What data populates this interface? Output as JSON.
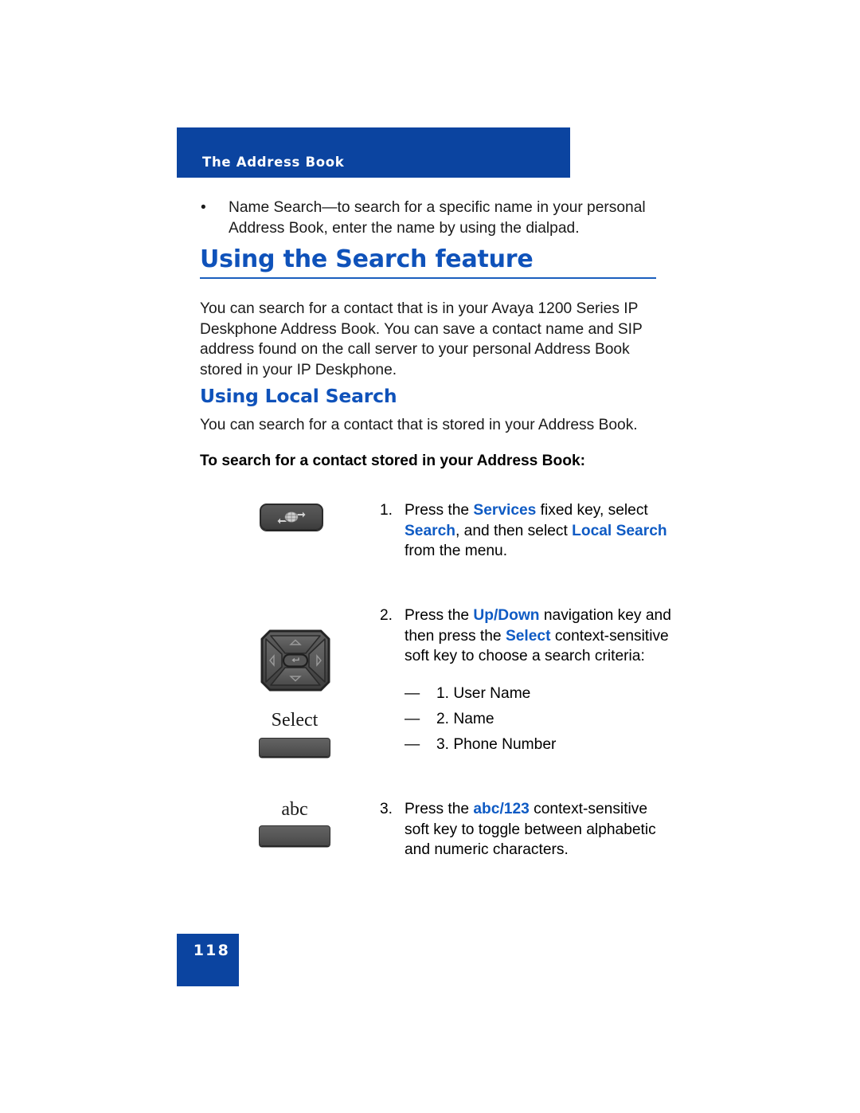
{
  "header": {
    "running_title": "The Address Book",
    "band_color": "#0b44a0"
  },
  "intro_bullet": {
    "marker": "•",
    "text": "Name Search—to search for a specific name in your personal Address Book, enter the name by using the dialpad."
  },
  "section": {
    "h1": "Using the Search feature",
    "h1_color": "#0f52ba",
    "paragraph": "You can search for a contact that is in your Avaya 1200 Series IP Deskphone Address Book. You can save a contact name and SIP address found on the call server to your personal Address Book stored in your IP Deskphone."
  },
  "subsection": {
    "h2": "Using Local Search",
    "h2_color": "#0f52ba",
    "paragraph": "You can search for a contact that is stored in your Address Book.",
    "lead_in": "To search for a contact stored in your Address Book:"
  },
  "steps": [
    {
      "number": "1.",
      "parts": [
        {
          "text": "Press the ",
          "style": "normal"
        },
        {
          "text": "Services",
          "style": "keyword"
        },
        {
          "text": " fixed key, select ",
          "style": "normal"
        },
        {
          "text": "Search",
          "style": "keyword"
        },
        {
          "text": ", and then select ",
          "style": "normal"
        },
        {
          "text": "Local Search",
          "style": "keyword"
        },
        {
          "text": " from the menu.",
          "style": "normal"
        }
      ],
      "icon": "services-fixed-key-icon"
    },
    {
      "number": "2.",
      "parts": [
        {
          "text": "Press the ",
          "style": "normal"
        },
        {
          "text": "Up/Down",
          "style": "keyword"
        },
        {
          "text": " navigation key and then press the ",
          "style": "normal"
        },
        {
          "text": "Select",
          "style": "keyword"
        },
        {
          "text": " context-sensitive soft key to choose a search criteria:",
          "style": "normal"
        }
      ],
      "sublist": [
        {
          "dash": "—",
          "text": "1. User Name"
        },
        {
          "dash": "—",
          "text": "2. Name"
        },
        {
          "dash": "—",
          "text": "3. Phone Number"
        }
      ],
      "icon": "navigation-cluster-icon"
    },
    {
      "number": "3.",
      "parts": [
        {
          "text": "Press the ",
          "style": "normal"
        },
        {
          "text": "abc/123",
          "style": "keyword"
        },
        {
          "text": " context-sensitive soft key to toggle between alphabetic and numeric characters.",
          "style": "normal"
        }
      ],
      "icon": "abc-soft-key-icon"
    }
  ],
  "softkeys": [
    {
      "label": "Select",
      "name": "select-soft-key"
    },
    {
      "label": "abc",
      "name": "abc-soft-key"
    }
  ],
  "footer": {
    "page_number": "118",
    "box_color": "#0b44a0"
  },
  "colors": {
    "brand_blue": "#0b44a0",
    "heading_blue": "#0f52ba",
    "keyword_blue": "#0f5bc4",
    "body_black": "#1a1a1a",
    "key_gray": "#4c4c4c"
  }
}
